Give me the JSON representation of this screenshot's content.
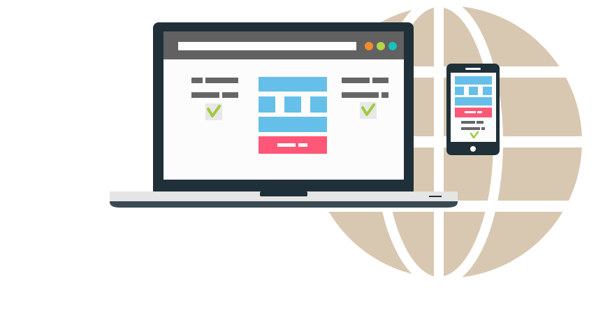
{
  "illustration": {
    "colors": {
      "globe": "#d8c8b2",
      "globe_lines": "#ffffff",
      "device_frame": "#1f3039",
      "browser_bar": "#616161",
      "address_bar": "#ffffff",
      "screen_bg": "#fcfcfc",
      "laptop_base": "#e5e5e5",
      "laptop_base_shadow": "#3a4a52",
      "blue_block": "#66bfe9",
      "pink_button": "#ff5777",
      "text_line": "#666666",
      "check": "#9ecb3c",
      "check_bg": "#e8e8e8",
      "dot_orange": "#f58c2b",
      "dot_green": "#b5d44a",
      "dot_teal": "#18c2b8"
    },
    "icons": {
      "globe": "globe-icon",
      "laptop": "laptop-icon",
      "phone": "smartphone-icon",
      "check": "checkmark-icon"
    }
  }
}
